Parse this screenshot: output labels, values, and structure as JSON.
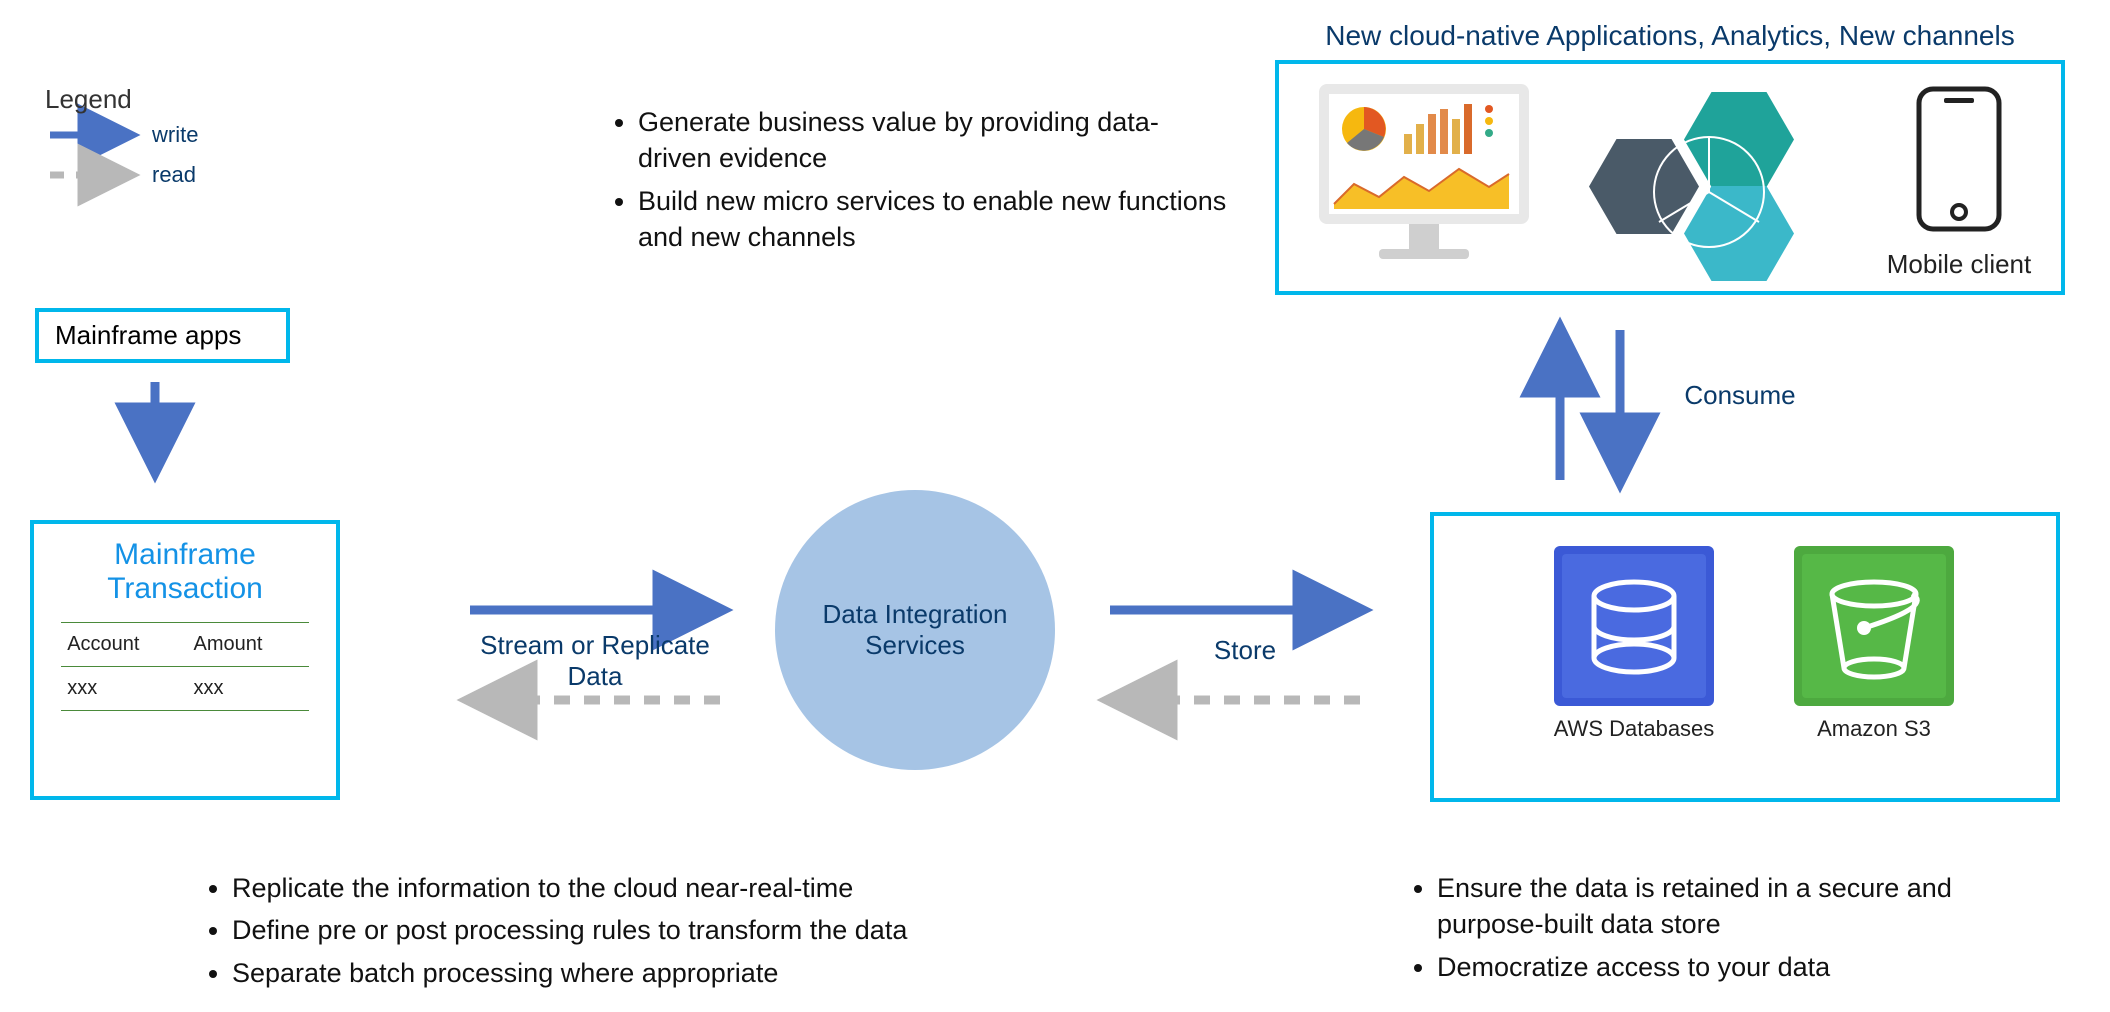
{
  "legend": {
    "title": "Legend",
    "write": "write",
    "read": "read"
  },
  "mainframe_apps_label": "Mainframe apps",
  "mainframe_card": {
    "title_line1": "Mainframe",
    "title_line2": "Transaction",
    "col1": "Account",
    "col2": "Amount",
    "val1": "xxx",
    "val2": "xxx"
  },
  "center_circle_line1": "Data Integration",
  "center_circle_line2": "Services",
  "flows": {
    "stream_line1": "Stream or Replicate",
    "stream_line2": "Data",
    "store": "Store",
    "consume": "Consume"
  },
  "top_bullets": {
    "b1": "Generate business value by providing data-driven evidence",
    "b2": "Build new micro services to enable new functions and new channels"
  },
  "cloud_header": "New cloud-native Applications, Analytics, New channels",
  "mobile_label": "Mobile client",
  "aws": {
    "db_label": "AWS Databases",
    "s3_label": "Amazon S3"
  },
  "left_bottom_bullets": {
    "b1": "Replicate the information to the cloud near-real-time",
    "b2": "Define pre or post processing rules to transform the data",
    "b3": "Separate batch processing where appropriate"
  },
  "right_bottom_bullets": {
    "b1": "Ensure the data is retained in a secure and purpose-built data store",
    "b2": "Democratize access to your data"
  },
  "colors": {
    "arrow_solid": "#4a72c4",
    "arrow_dashed": "#b8b8b8",
    "cyan_border": "#00b7eb",
    "circle_fill": "#a6c4e5",
    "navy_text": "#0a3a6a",
    "hex_dark": "#4a5a68",
    "hex_teal": "#1fa39a",
    "hex_cyan": "#3bb8c9",
    "aws_db": "#3b59d6",
    "aws_s3": "#4da93f"
  }
}
